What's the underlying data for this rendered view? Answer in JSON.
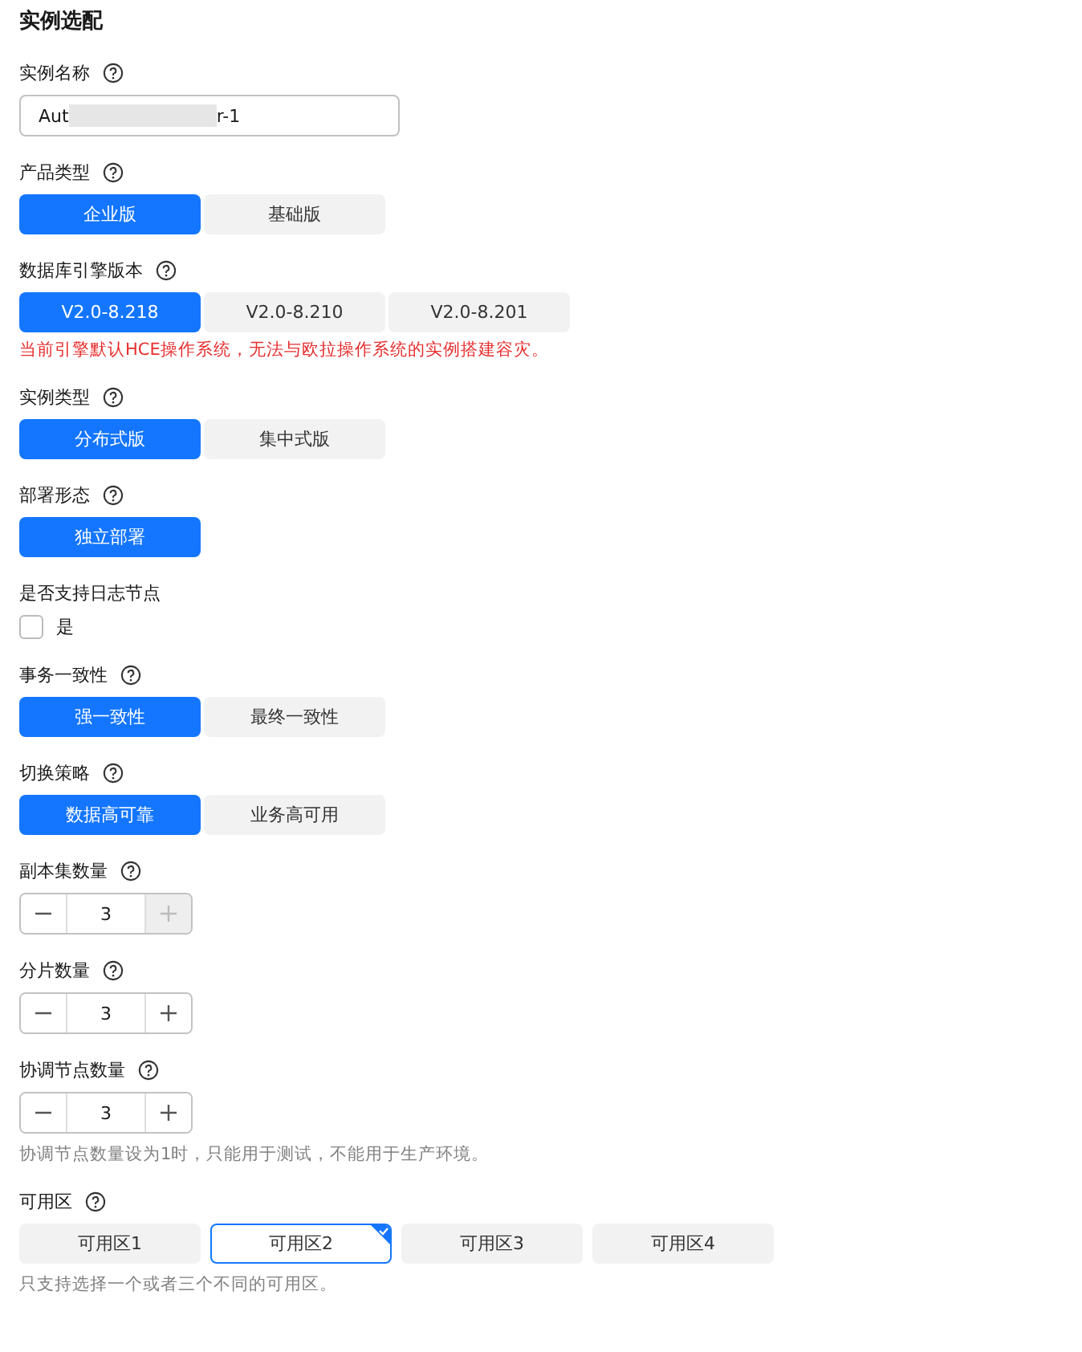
{
  "title": "实例选配",
  "fields": [
    {
      "kind": "input",
      "label": "实例名称",
      "help": true,
      "value_start": "Aut",
      "value_end": "r-1"
    },
    {
      "kind": "segmented",
      "label": "产品类型",
      "help": true,
      "options": [
        {
          "label": "企业版",
          "selected": true
        },
        {
          "label": "基础版",
          "selected": false
        }
      ]
    },
    {
      "kind": "segmented",
      "label": "数据库引擎版本",
      "help": true,
      "options": [
        {
          "label": "V2.0-8.218",
          "selected": true
        },
        {
          "label": "V2.0-8.210",
          "selected": false
        },
        {
          "label": "V2.0-8.201",
          "selected": false
        }
      ],
      "warning": "当前引擎默认HCE操作系统，无法与欧拉操作系统的实例搭建容灾。"
    },
    {
      "kind": "segmented",
      "label": "实例类型",
      "help": true,
      "options": [
        {
          "label": "分布式版",
          "selected": true
        },
        {
          "label": "集中式版",
          "selected": false
        }
      ]
    },
    {
      "kind": "segmented",
      "label": "部署形态",
      "help": true,
      "options": [
        {
          "label": "独立部署",
          "selected": true
        }
      ]
    },
    {
      "kind": "checkbox",
      "label": "是否支持日志节点",
      "option": "是",
      "checked": false
    },
    {
      "kind": "segmented",
      "label": "事务一致性",
      "help": true,
      "options": [
        {
          "label": "强一致性",
          "selected": true
        },
        {
          "label": "最终一致性",
          "selected": false
        }
      ]
    },
    {
      "kind": "segmented",
      "label": "切换策略",
      "help": true,
      "options": [
        {
          "label": "数据高可靠",
          "selected": true
        },
        {
          "label": "业务高可用",
          "selected": false
        }
      ]
    },
    {
      "kind": "stepper",
      "label": "副本集数量",
      "help": true,
      "value": "3",
      "minus_disabled": false,
      "plus_disabled": true
    },
    {
      "kind": "stepper",
      "label": "分片数量",
      "help": true,
      "value": "3",
      "minus_disabled": false,
      "plus_disabled": false
    },
    {
      "kind": "stepper",
      "label": "协调节点数量",
      "help": true,
      "value": "3",
      "minus_disabled": false,
      "plus_disabled": false,
      "hint": "协调节点数量设为1时，只能用于测试，不能用于生产环境。"
    },
    {
      "kind": "zones",
      "label": "可用区",
      "help": true,
      "options": [
        {
          "label": "可用区1",
          "selected": false
        },
        {
          "label": "可用区2",
          "selected": true
        },
        {
          "label": "可用区3",
          "selected": false
        },
        {
          "label": "可用区4",
          "selected": false
        }
      ],
      "hint": "只支持选择一个或者三个不同的可用区。"
    }
  ]
}
